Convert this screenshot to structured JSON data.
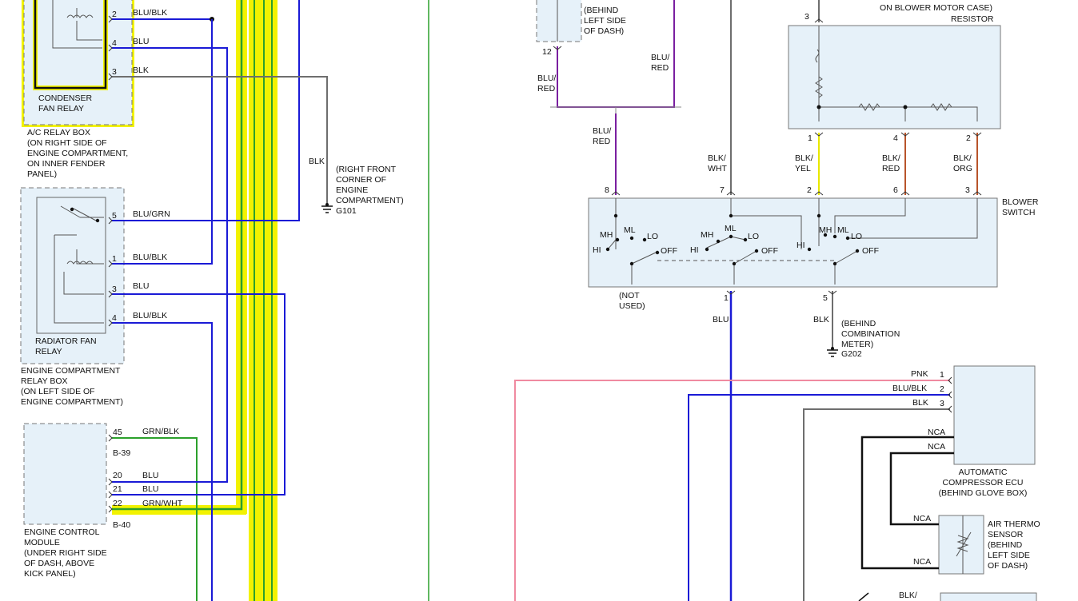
{
  "components": {
    "condenser_relay": "CONDENSER\nFAN RELAY",
    "ac_relay_box": "A/C RELAY BOX\n(ON RIGHT SIDE OF\nENGINE COMPARTMENT,\nON INNER FENDER\nPANEL)",
    "radiator_relay": "RADIATOR FAN\nRELAY",
    "engine_relay_box": "ENGINE COMPARTMENT\nRELAY BOX\n(ON LEFT SIDE OF\nENGINE COMPARTMENT)",
    "ecm": "ENGINE CONTROL\nMODULE\n(UNDER RIGHT SIDE\nOF DASH, ABOVE\nKICK PANEL)",
    "g101": "(RIGHT FRONT\nCORNER OF\nENGINE\nCOMPARTMENT)",
    "g101_id": "G101",
    "behind_left_dash_top": "(BEHIND\nLEFT SIDE\nOF DASH)",
    "blower_case_top": "ON BLOWER MOTOR CASE)",
    "resistor": "RESISTOR",
    "blower_switch": "BLOWER\nSWITCH",
    "not_used": "(NOT\nUSED)",
    "g202": "(BEHIND\nCOMBINATION\nMETER)",
    "g202_id": "G202",
    "compressor_ecu": "AUTOMATIC\nCOMPRESSOR ECU\n(BEHIND GLOVE BOX)",
    "air_thermo": "AIR THERMO\nSENSOR\n(BEHIND\nLEFT SIDE\nOF DASH)"
  },
  "connectors": {
    "b39": "B-39",
    "b40": "B-40"
  },
  "pins": {
    "ac2": "2",
    "ac4": "4",
    "ac3": "3",
    "rf5": "5",
    "rf1": "1",
    "rf3": "3",
    "rf4": "4",
    "ecm45": "45",
    "ecm20": "20",
    "ecm21": "21",
    "ecm22": "22",
    "dash12": "12",
    "res3": "3",
    "res1": "1",
    "res4": "4",
    "res2": "2",
    "bs8": "8",
    "bs7": "7",
    "bs2": "2",
    "bs6": "6",
    "bs3": "3",
    "bs1": "1",
    "bs5": "5",
    "ecu1": "1",
    "ecu2": "2",
    "ecu3": "3"
  },
  "wires": {
    "blu_blk_a": "BLU/BLK",
    "blu_a": "BLU",
    "blk_a": "BLK",
    "blk_g101": "BLK",
    "blu_grn": "BLU/GRN",
    "blu_blk_b": "BLU/BLK",
    "blu_b": "BLU",
    "blu_blk_c": "BLU/BLK",
    "grn_blk": "GRN/BLK",
    "blu_c": "BLU",
    "blu_d": "BLU",
    "grn_wht": "GRN/WHT",
    "blu_red_a": "BLU/\nRED",
    "blu_red_b": "BLU/\nRED",
    "blu_red_c": "BLU/\nRED",
    "blk_wht": "BLK/\nWHT",
    "blk_yel": "BLK/\nYEL",
    "blk_red": "BLK/\nRED",
    "blk_org": "BLK/\nORG",
    "blu_out": "BLU",
    "blk_g202": "BLK",
    "pnk": "PNK",
    "blu_blk_ecu": "BLU/BLK",
    "blk_ecu": "BLK",
    "nca1": "NCA",
    "nca2": "NCA",
    "nca3": "NCA",
    "nca4": "NCA",
    "blk_bottom": "BLK/"
  },
  "switch_labels": {
    "mh1": "MH",
    "ml1": "ML",
    "lo1": "LO",
    "hi1": "HI",
    "off1": "OFF",
    "mh2": "MH",
    "ml2": "ML",
    "lo2": "LO",
    "hi2": "HI",
    "off2": "OFF",
    "hi3": "HI",
    "mh3": "MH",
    "ml3": "ML",
    "lo3": "LO",
    "off3": "OFF"
  },
  "colors": {
    "blue": "#1a1ad6",
    "yellow": "#f2f200",
    "green": "#2ca02c",
    "black": "#111111",
    "gray": "#6e6e6e",
    "purple": "#7a1fa0",
    "pink": "#f08aa0",
    "brown": "#b8542a",
    "red": "#c41e1e",
    "box_fill": "#e6f1f9"
  }
}
